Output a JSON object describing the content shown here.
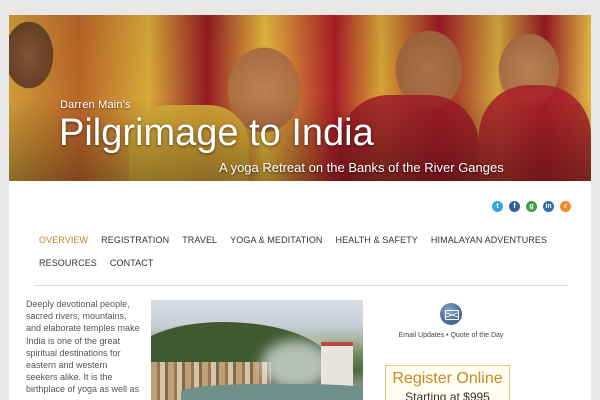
{
  "banner": {
    "subtitle": "Darren Main's",
    "title": "Pilgrimage to India",
    "tagline": "A yoga Retreat on the Banks of the River Ganges"
  },
  "social": [
    {
      "name": "twitter-icon",
      "glyph": "t",
      "color": "#3aa3dc"
    },
    {
      "name": "facebook-icon",
      "glyph": "f",
      "color": "#3b5b9a"
    },
    {
      "name": "google-icon",
      "glyph": "g",
      "color": "#3d9d4a"
    },
    {
      "name": "linkedin-icon",
      "glyph": "in",
      "color": "#2a6ea8"
    },
    {
      "name": "rss-icon",
      "glyph": "r",
      "color": "#f08a2a"
    }
  ],
  "nav": {
    "items": [
      {
        "label": "OVERVIEW",
        "active": true
      },
      {
        "label": "REGISTRATION",
        "active": false
      },
      {
        "label": "TRAVEL",
        "active": false
      },
      {
        "label": "YOGA & MEDITATION",
        "active": false
      },
      {
        "label": "HEALTH & SAFETY",
        "active": false
      },
      {
        "label": "HIMALAYAN ADVENTURES",
        "active": false
      },
      {
        "label": "RESOURCES",
        "active": false
      },
      {
        "label": "CONTACT",
        "active": false
      }
    ]
  },
  "intro": {
    "text": "Deeply devotional people, sacred rivers, mountains, and elaborate temples make India is one of the great spiritual destinations for eastern and western seekers alike.  It is the birthplace of yoga as well as"
  },
  "sidebar": {
    "email_label": "Email Updates • Quote of the Day",
    "register_title": "Register Online",
    "register_price": "Starting at $995"
  },
  "colors": {
    "accent": "#c0862b",
    "nav_text": "#333333",
    "body_text": "#555555"
  }
}
